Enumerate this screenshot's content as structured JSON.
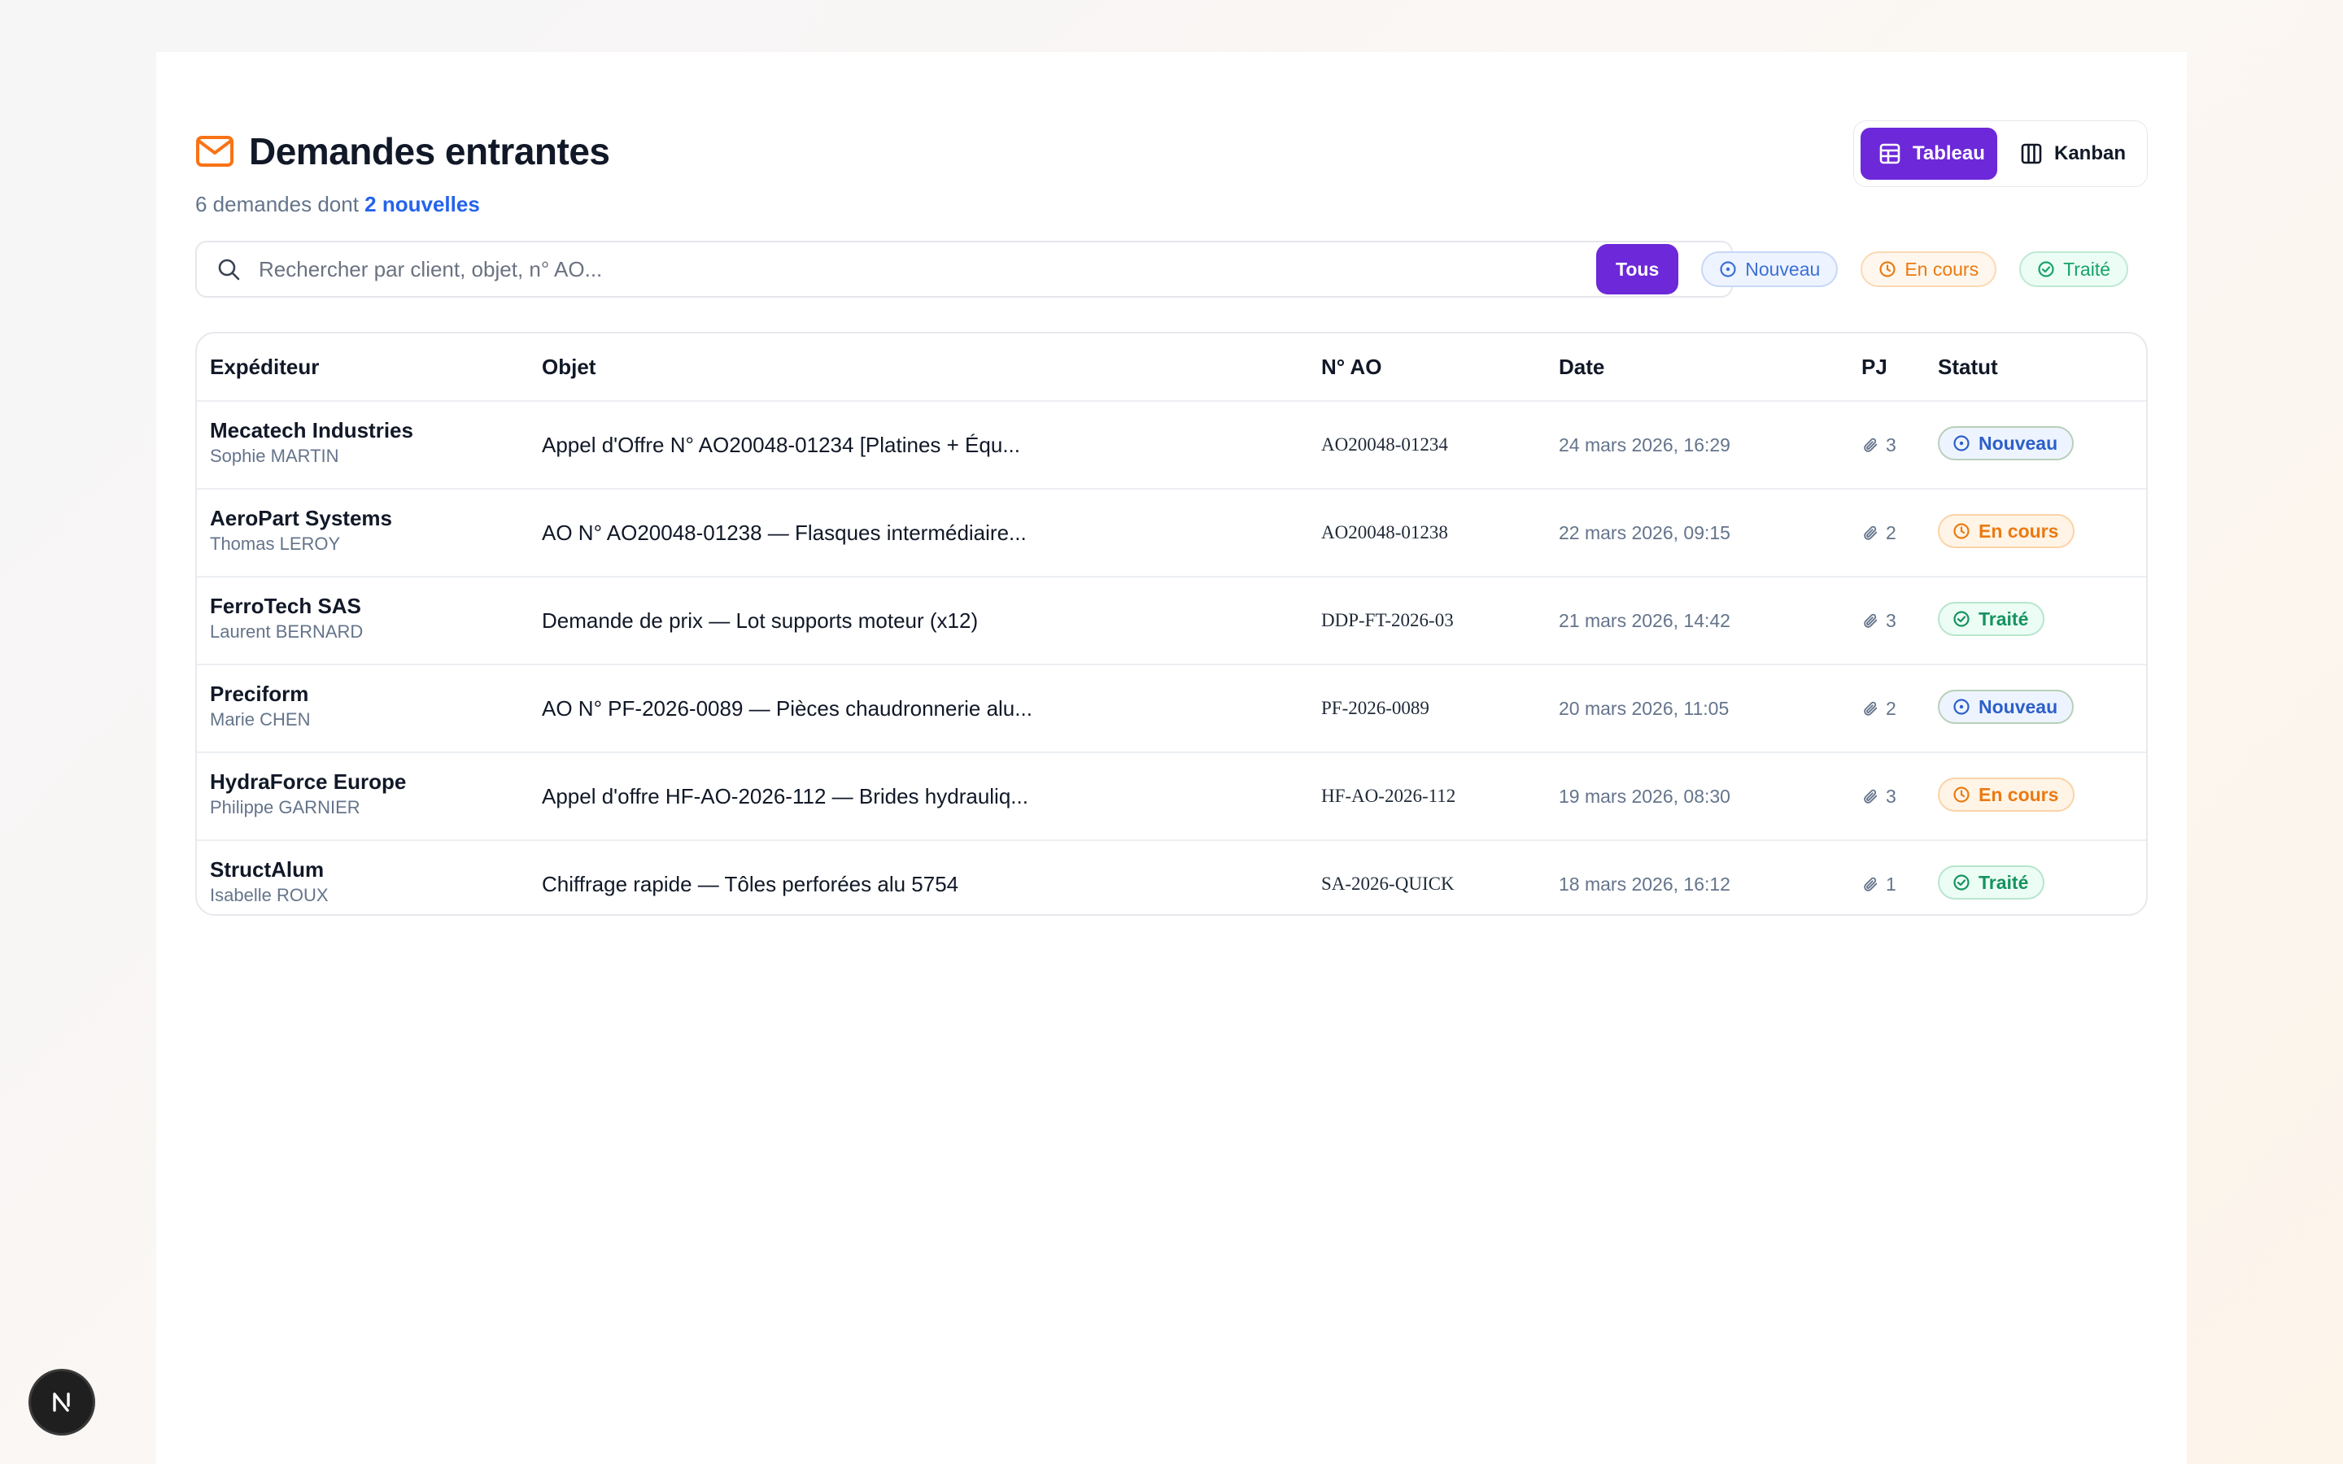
{
  "header": {
    "title": "Demandes entrantes",
    "subtitle_prefix": "6 demandes dont",
    "subtitle_new": "2 nouvelles"
  },
  "view_toggle": {
    "table_label": "Tableau",
    "kanban_label": "Kanban"
  },
  "search": {
    "placeholder": "Rechercher par client, objet, n° AO..."
  },
  "filters": {
    "all": "Tous",
    "new": "Nouveau",
    "in_progress": "En cours",
    "done": "Traité"
  },
  "table": {
    "columns": [
      "Expéditeur",
      "Objet",
      "N° AO",
      "Date",
      "PJ",
      "Statut"
    ],
    "rows": [
      {
        "sender": "Mecatech Industries",
        "contact": "Sophie MARTIN",
        "subject": "Appel d'Offre N° AO20048-01234 [Platines + Équ...",
        "ao": "AO20048-01234",
        "date": "24 mars 2026, 16:29",
        "pj": "3",
        "status": "Nouveau"
      },
      {
        "sender": "AeroPart Systems",
        "contact": "Thomas LEROY",
        "subject": "AO N° AO20048-01238 — Flasques intermédiaire...",
        "ao": "AO20048-01238",
        "date": "22 mars 2026, 09:15",
        "pj": "2",
        "status": "En cours"
      },
      {
        "sender": "FerroTech SAS",
        "contact": "Laurent BERNARD",
        "subject": "Demande de prix — Lot supports moteur (x12)",
        "ao": "DDP-FT-2026-03",
        "date": "21 mars 2026, 14:42",
        "pj": "3",
        "status": "Traité"
      },
      {
        "sender": "Preciform",
        "contact": "Marie CHEN",
        "subject": "AO N° PF-2026-0089 — Pièces chaudronnerie alu...",
        "ao": "PF-2026-0089",
        "date": "20 mars 2026, 11:05",
        "pj": "2",
        "status": "Nouveau"
      },
      {
        "sender": "HydraForce Europe",
        "contact": "Philippe GARNIER",
        "subject": "Appel d'offre HF-AO-2026-112 — Brides hydrauliq...",
        "ao": "HF-AO-2026-112",
        "date": "19 mars 2026, 08:30",
        "pj": "3",
        "status": "En cours"
      },
      {
        "sender": "StructAlum",
        "contact": "Isabelle ROUX",
        "subject": "Chiffrage rapide — Tôles perforées alu 5754",
        "ao": "SA-2026-QUICK",
        "date": "18 mars 2026, 16:12",
        "pj": "1",
        "status": "Traité"
      }
    ]
  },
  "icons": {
    "title": "mail-icon",
    "search": "search-icon",
    "table_view": "table-icon",
    "kanban_view": "columns-icon",
    "attachment": "paperclip-icon",
    "nouveau": "circle-dot-icon",
    "en_cours": "clock-icon",
    "traite": "check-circle-icon",
    "framework": "next-logo-icon"
  },
  "colors": {
    "accent": "#6d28d9",
    "mail_icon": "#f97316",
    "link_blue": "#2563eb",
    "nouveau": "#2c5fc9",
    "en_cours": "#ea7a12",
    "traite": "#15935f"
  }
}
